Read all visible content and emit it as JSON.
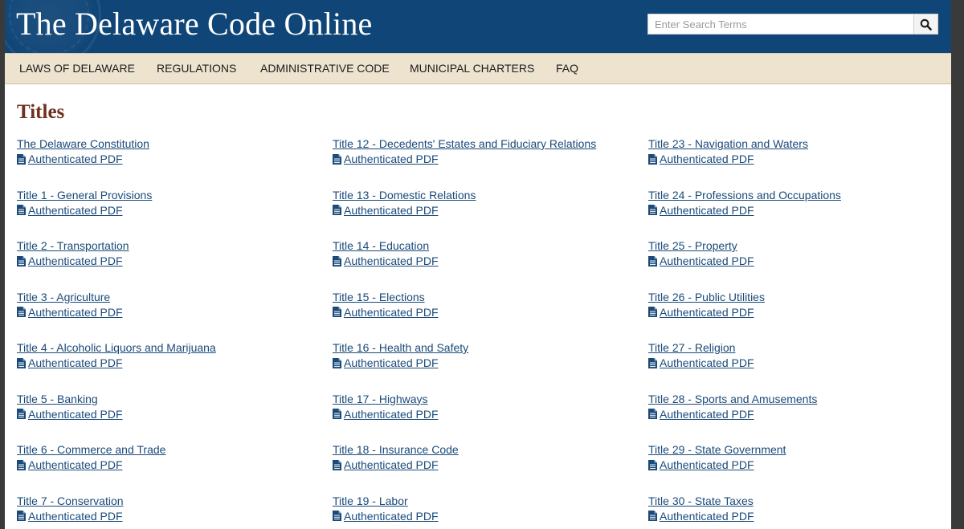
{
  "header": {
    "site_title": "The Delaware Code Online",
    "search_placeholder": "Enter Search Terms"
  },
  "nav": {
    "items": [
      {
        "label": "LAWS OF DELAWARE"
      },
      {
        "label": "REGULATIONS"
      },
      {
        "label": "ADMINISTRATIVE CODE"
      },
      {
        "label": "MUNICIPAL CHARTERS"
      },
      {
        "label": "FAQ"
      }
    ]
  },
  "content": {
    "heading": "Titles",
    "pdf_label": "Authenticated PDF",
    "columns": [
      [
        {
          "title": "The Delaware Constitution"
        },
        {
          "title": "Title 1 - General Provisions"
        },
        {
          "title": "Title 2 - Transportation"
        },
        {
          "title": "Title 3 - Agriculture"
        },
        {
          "title": "Title 4 - Alcoholic Liquors and Marijuana"
        },
        {
          "title": "Title 5 - Banking"
        },
        {
          "title": "Title 6 - Commerce and Trade"
        },
        {
          "title": "Title 7 - Conservation"
        }
      ],
      [
        {
          "title": "Title 12 - Decedents' Estates and Fiduciary Relations"
        },
        {
          "title": "Title 13 - Domestic Relations"
        },
        {
          "title": "Title 14 - Education"
        },
        {
          "title": "Title 15 - Elections"
        },
        {
          "title": "Title 16 - Health and Safety"
        },
        {
          "title": "Title 17 - Highways"
        },
        {
          "title": "Title 18 - Insurance Code"
        },
        {
          "title": "Title 19 - Labor"
        }
      ],
      [
        {
          "title": "Title 23 - Navigation and Waters"
        },
        {
          "title": "Title 24 - Professions and Occupations"
        },
        {
          "title": "Title 25 - Property"
        },
        {
          "title": "Title 26 - Public Utilities"
        },
        {
          "title": "Title 27 - Religion"
        },
        {
          "title": "Title 28 - Sports and Amusements"
        },
        {
          "title": "Title 29 - State Government"
        },
        {
          "title": "Title 30 - State Taxes"
        }
      ]
    ]
  },
  "colors": {
    "header_bg": "#0f4577",
    "nav_bg": "#ede3cf",
    "heading": "#70301e",
    "link": "#1a4a7a"
  },
  "icons": {
    "search": "magnifier-icon",
    "pdf": "document-icon"
  }
}
